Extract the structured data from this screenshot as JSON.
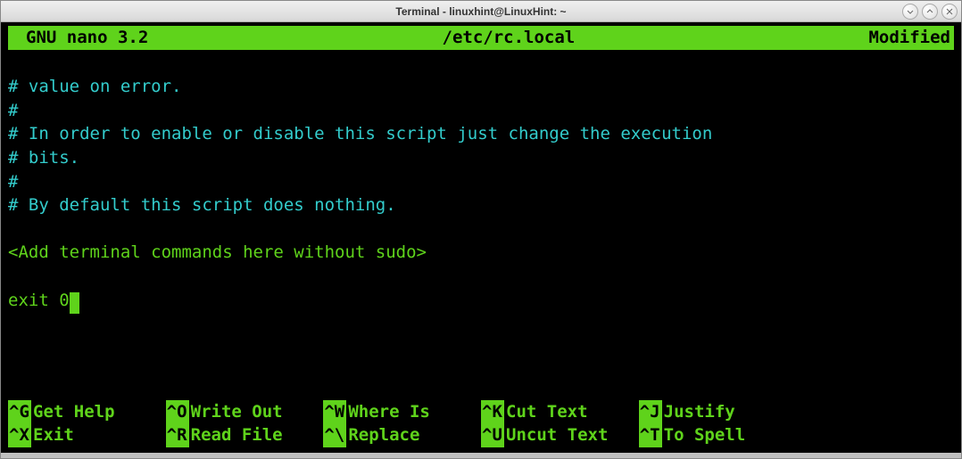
{
  "titlebar": {
    "title": "Terminal - linuxhint@LinuxHint: ~"
  },
  "nano_header": {
    "version": "GNU nano 3.2",
    "filename": "/etc/rc.local",
    "status": "Modified"
  },
  "content": {
    "line1": "# value on error.",
    "line2": "#",
    "line3": "# In order to enable or disable this script just change the execution",
    "line4": "# bits.",
    "line5": "#",
    "line6": "# By default this script does nothing.",
    "line7": "",
    "line8": "<Add terminal commands here without sudo>",
    "line9": "",
    "line10": "exit 0"
  },
  "shortcuts": {
    "help": {
      "key": "^G",
      "label": "Get Help"
    },
    "writeout": {
      "key": "^O",
      "label": "Write Out"
    },
    "whereis": {
      "key": "^W",
      "label": "Where Is"
    },
    "cut": {
      "key": "^K",
      "label": "Cut Text"
    },
    "justify": {
      "key": "^J",
      "label": "Justify"
    },
    "exit": {
      "key": "^X",
      "label": "Exit"
    },
    "readfile": {
      "key": "^R",
      "label": "Read File"
    },
    "replace": {
      "key": "^\\",
      "label": "Replace"
    },
    "uncut": {
      "key": "^U",
      "label": "Uncut Text"
    },
    "tospell": {
      "key": "^T",
      "label": "To Spell"
    }
  }
}
